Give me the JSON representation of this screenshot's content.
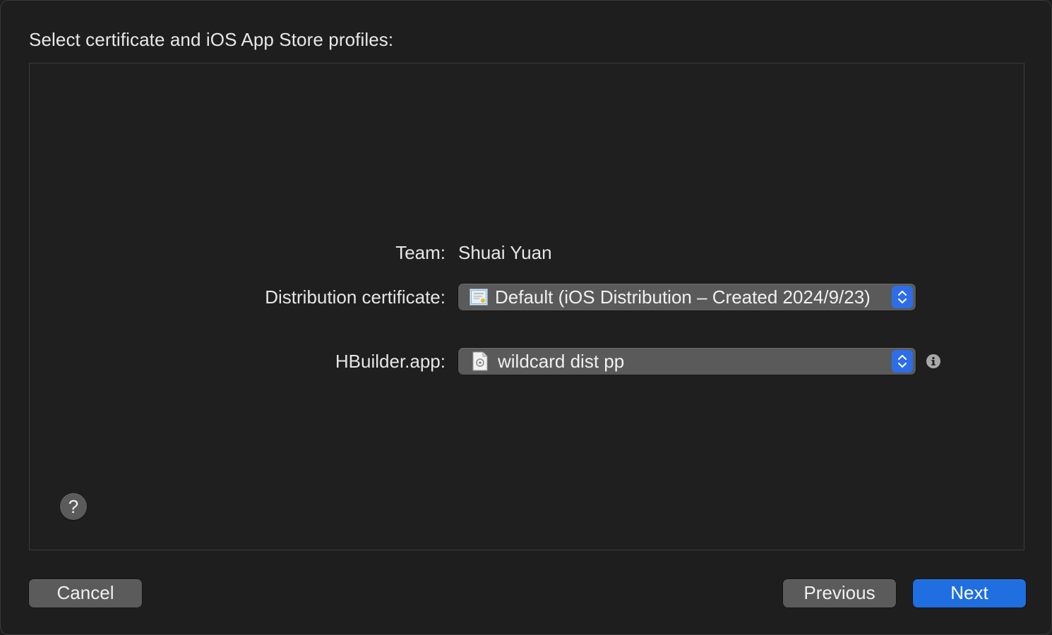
{
  "dialog": {
    "heading": "Select certificate and iOS App Store profiles:"
  },
  "form": {
    "team_label": "Team:",
    "team_value": "Shuai Yuan",
    "cert_label": "Distribution certificate:",
    "cert_value": "Default (iOS Distribution – Created 2024/9/23)",
    "profile_label": "HBuilder.app:",
    "profile_value": "wildcard dist pp"
  },
  "help": {
    "label": "?"
  },
  "footer": {
    "cancel_label": "Cancel",
    "previous_label": "Previous",
    "next_label": "Next"
  },
  "colors": {
    "accent": "#1f6fe0",
    "background": "#1e1e1e",
    "control": "#5a5a5a"
  },
  "icons": {
    "certificate": "certificate-icon",
    "profile": "provisioning-profile-icon",
    "stepper": "chevron-up-down-icon",
    "info": "info-icon"
  }
}
